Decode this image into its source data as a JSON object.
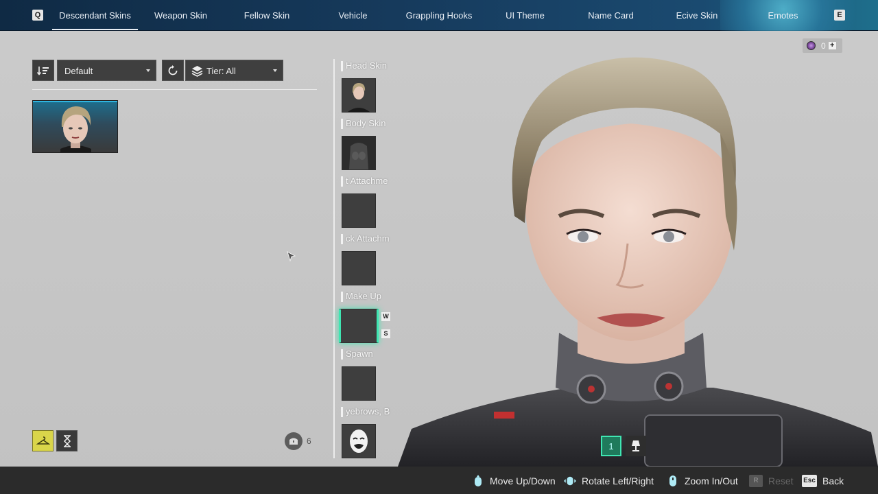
{
  "nav": {
    "left_key": "Q",
    "right_key": "E",
    "tabs": [
      {
        "label": "Descendant Skins"
      },
      {
        "label": "Weapon Skin"
      },
      {
        "label": "Fellow Skin"
      },
      {
        "label": "Vehicle"
      },
      {
        "label": "Grappling Hooks"
      },
      {
        "label": "UI Theme"
      },
      {
        "label": "Name Card"
      },
      {
        "label": "Ecive Skin"
      },
      {
        "label": "Emotes"
      }
    ],
    "active_tab": "Descendant Skins"
  },
  "filters": {
    "sort_value": "Default",
    "tier_value": "Tier: All"
  },
  "slots": [
    {
      "label": "Head Skin"
    },
    {
      "label": "Body Skin"
    },
    {
      "label": "t Attachme"
    },
    {
      "label": "ck Attachm"
    },
    {
      "label": "Make Up"
    },
    {
      "label": "Spawn"
    },
    {
      "label": "yebrows, B"
    }
  ],
  "makeup_keys": {
    "up": "W",
    "down": "S"
  },
  "inventory_count": "6",
  "currency": {
    "value": "0",
    "plus": "+"
  },
  "preset": {
    "number": "1"
  },
  "bottom_hints": {
    "move": "Move Up/Down",
    "rotate": "Rotate Left/Right",
    "zoom": "Zoom In/Out",
    "reset_key": "R",
    "reset": "Reset",
    "back_key": "Esc",
    "back": "Back"
  },
  "colors": {
    "nav_bg": "#163a5c",
    "accent_selected": "#3fe6b2",
    "highlight_yellow": "#d9d54a",
    "bottom_bar": "#2b2b2b"
  }
}
